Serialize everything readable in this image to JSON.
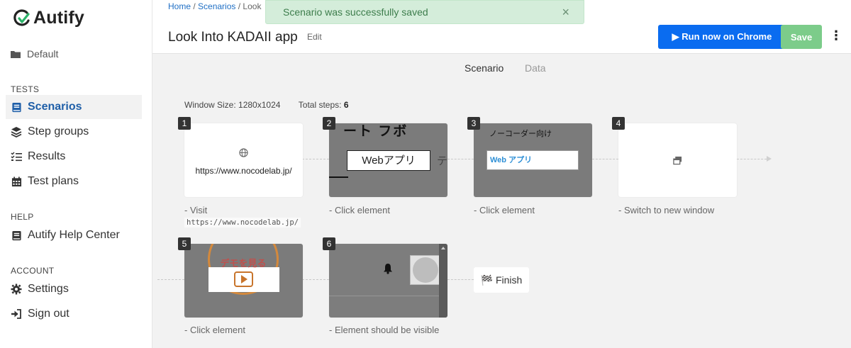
{
  "brand": {
    "name": "Autify"
  },
  "sidebar": {
    "project": "Default",
    "sections": {
      "tests": "TESTS",
      "help": "HELP",
      "account": "ACCOUNT"
    },
    "items": [
      {
        "label": "Scenarios",
        "icon": "book-icon"
      },
      {
        "label": "Step groups",
        "icon": "layers-icon"
      },
      {
        "label": "Results",
        "icon": "list-check-icon"
      },
      {
        "label": "Test plans",
        "icon": "calendar-icon"
      },
      {
        "label": "Autify Help Center",
        "icon": "book-icon"
      },
      {
        "label": "Settings",
        "icon": "gear-icon"
      },
      {
        "label": "Sign out",
        "icon": "sign-out-icon"
      }
    ]
  },
  "header": {
    "breadcrumb": {
      "home": "Home",
      "scenarios": "Scenarios",
      "current": "Look"
    },
    "title": "Look Into KADAII app",
    "edit_label": "Edit",
    "run_label": "▶ Run now on Chrome",
    "save_label": "Save",
    "more_label": "⋮"
  },
  "toast": {
    "message": "Scenario was successfully saved",
    "close": "×"
  },
  "tabs": {
    "scenario": "Scenario",
    "data": "Data"
  },
  "meta": {
    "window_size": "Window Size: 1280x1024",
    "total_steps_label": "Total steps:",
    "total_steps_value": "6"
  },
  "steps": [
    {
      "num": "1",
      "url_text": "https://www.nocodelab.jp/",
      "desc_prefix": "- Visit",
      "desc_code": "https://www.nocodelab.jp/"
    },
    {
      "num": "2",
      "thumb_text_top": "ート フボ",
      "thumb_button": "Webアプリ",
      "thumb_side": "テ",
      "desc": "- Click element"
    },
    {
      "num": "3",
      "thumb_text_top": "ノーコーダー向け",
      "thumb_button": "Web アプリ",
      "desc": "- Click element"
    },
    {
      "num": "4",
      "desc": "- Switch to new window"
    },
    {
      "num": "5",
      "thumb_text_top": "デモを見る",
      "desc": "- Click element"
    },
    {
      "num": "6",
      "desc": "- Element should be visible"
    }
  ],
  "finish_label": "🏁 Finish",
  "colors": {
    "primary": "#0a6cf0",
    "save": "#7ccc8a",
    "active_nav": "#1f5fa8",
    "toast_bg": "#d4edda"
  }
}
